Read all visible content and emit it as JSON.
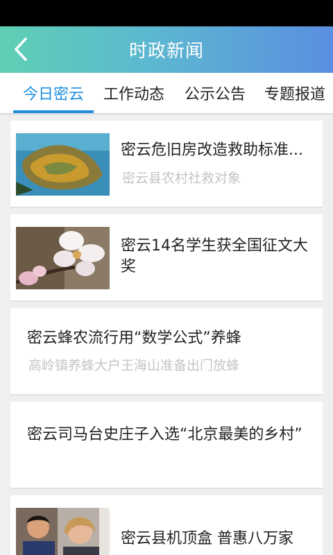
{
  "header": {
    "title": "时政新闻",
    "back_icon": "chevron-left-icon"
  },
  "tabs": [
    {
      "label": "今日密云",
      "active": true
    },
    {
      "label": "工作动态",
      "active": false
    },
    {
      "label": "公示公告",
      "active": false
    },
    {
      "label": "专题报道",
      "active": false
    }
  ],
  "colors": {
    "accent": "#1e8ee0",
    "header_gradient": [
      "#5fcfb4",
      "#5a8fe0"
    ],
    "subtitle": "#c4c4c4"
  },
  "news": [
    {
      "title": "密云危旧房改造救助标准...",
      "subtitle": "密云县农村社救对象",
      "image": "aerial-island-photo"
    },
    {
      "title": "密云14名学生获全国征文大奖",
      "subtitle": "",
      "image": "white-blossom-photo"
    },
    {
      "title": "密云蜂农流行用“数学公式”养蜂",
      "subtitle": "高岭镇养蜂大户王海山准备出门放蜂",
      "image": ""
    },
    {
      "title": "密云司马台史庄子入选“北京最美的乡村”",
      "subtitle": "",
      "image": ""
    },
    {
      "title": "密云县机顶盒 普惠八万家",
      "subtitle": "",
      "image": "people-photo"
    }
  ]
}
